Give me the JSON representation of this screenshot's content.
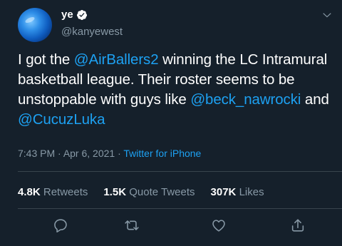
{
  "author": {
    "display_name": "ye",
    "handle": "@kanyewest",
    "verified": true
  },
  "tweet": {
    "segments": [
      {
        "text": "I got the ",
        "mention": false
      },
      {
        "text": "@AirBallers2",
        "mention": true
      },
      {
        "text": " winning the LC Intramural basketball league. Their roster seems to be unstoppable with guys like ",
        "mention": false
      },
      {
        "text": "@beck_nawrocki",
        "mention": true
      },
      {
        "text": " and ",
        "mention": false
      },
      {
        "text": "@CucuzLuka",
        "mention": true
      }
    ]
  },
  "meta": {
    "time": "7:43 PM",
    "sep1": " · ",
    "date": "Apr 6, 2021",
    "sep2": " · ",
    "source": "Twitter for iPhone"
  },
  "stats": {
    "retweets_count": "4.8K",
    "retweets_label": "Retweets",
    "quotes_count": "1.5K",
    "quotes_label": "Quote Tweets",
    "likes_count": "307K",
    "likes_label": "Likes"
  },
  "actions": [
    "reply-icon",
    "retweet-icon",
    "like-icon",
    "share-icon"
  ],
  "colors": {
    "background": "#15202b",
    "text": "#ffffff",
    "muted": "#8899a6",
    "accent": "#1da1f2",
    "divider": "#38444d"
  }
}
